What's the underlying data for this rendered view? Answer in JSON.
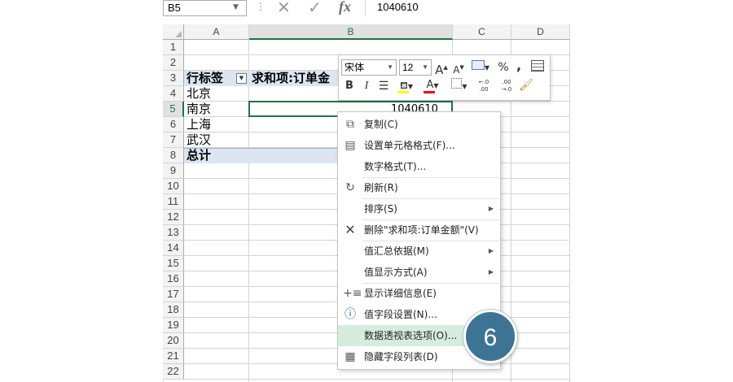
{
  "formula_bar": {
    "name_box": "B5",
    "cancel_icon": "x-icon",
    "confirm_icon": "check-icon",
    "fx_label": "fx",
    "value": "1040610"
  },
  "columns": [
    "A",
    "B",
    "C",
    "D"
  ],
  "selected_column": "B",
  "rows": [
    "1",
    "2",
    "3",
    "4",
    "5",
    "6",
    "7",
    "8",
    "9",
    "10",
    "11",
    "12",
    "13",
    "14",
    "15",
    "16",
    "17",
    "18",
    "19",
    "20",
    "21",
    "22"
  ],
  "selected_row": "5",
  "pivot": {
    "row_label_header": "行标签",
    "value_header": "求和项:订单金",
    "rows": [
      "北京",
      "南京",
      "上海",
      "武汉"
    ],
    "total_label": "总计",
    "active_value": "1040610"
  },
  "mini_toolbar": {
    "font_name": "宋体",
    "font_size": "12",
    "grow_font": "A",
    "shrink_font": "A",
    "percent": "%",
    "comma": ",",
    "bold": "B",
    "italic": "I",
    "font_color": "A",
    "inc_decimal": "←.0 .00",
    "dec_decimal": ".00 →.0"
  },
  "context_menu": {
    "items": [
      {
        "label": "复制(C)",
        "icon": "copy-icon"
      },
      {
        "label": "设置单元格格式(F)...",
        "icon": "format-cells-icon"
      },
      {
        "label": "数字格式(T)...",
        "icon": ""
      },
      {
        "label": "刷新(R)",
        "icon": "refresh-icon"
      },
      {
        "label": "排序(S)",
        "icon": "",
        "submenu": true
      },
      {
        "label": "删除\"求和项:订单金额\"(V)",
        "icon": "delete-icon"
      },
      {
        "label": "值汇总依据(M)",
        "icon": "",
        "submenu": true
      },
      {
        "label": "值显示方式(A)",
        "icon": "",
        "submenu": true
      },
      {
        "label": "显示详细信息(E)",
        "icon": "show-details-icon"
      },
      {
        "label": "值字段设置(N)...",
        "icon": "field-settings-icon"
      },
      {
        "label": "数据透视表选项(O)...",
        "icon": "",
        "highlighted": true
      },
      {
        "label": "隐藏字段列表(D)",
        "icon": "field-list-icon"
      }
    ]
  },
  "step_badge": "6",
  "colors": {
    "excel_green": "#217346",
    "pivot_header_bg": "#dce6f1",
    "menu_highlight": "#d6ecdf",
    "badge": "#3d7494"
  }
}
